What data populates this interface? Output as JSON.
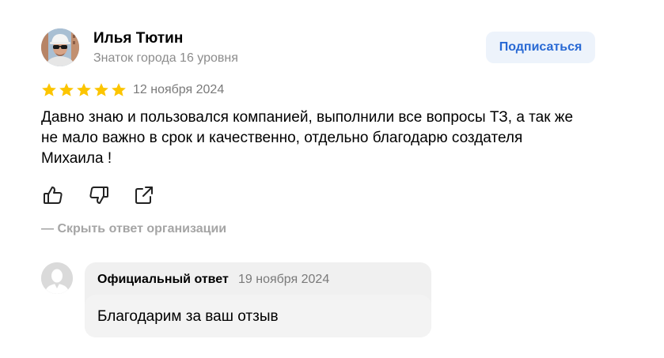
{
  "review": {
    "author": {
      "name": "Илья Тютин",
      "rank": "Знаток города 16 уровня"
    },
    "subscribe_label": "Подписаться",
    "rating": 5,
    "date": "12 ноября 2024",
    "text": "Давно знаю и пользовался компанией, выполнили все вопросы ТЗ, а так же не мало важно в срок и качественно, отдельно благодарю создателя Михаила !",
    "actions": {
      "like_icon": "thumbs-up-icon",
      "dislike_icon": "thumbs-down-icon",
      "share_icon": "share-icon"
    },
    "hide_reply_label": "— Скрыть ответ организации"
  },
  "reply": {
    "label": "Официальный ответ",
    "date": "19 ноября 2024",
    "text": "Благодарим за ваш отзыв"
  },
  "colors": {
    "star": "#fcc500",
    "accent": "#2869d4",
    "subscribe_bg": "#edf3fb",
    "muted_text": "#8c8c8c",
    "bubble_bg": "#f0f0f0"
  }
}
